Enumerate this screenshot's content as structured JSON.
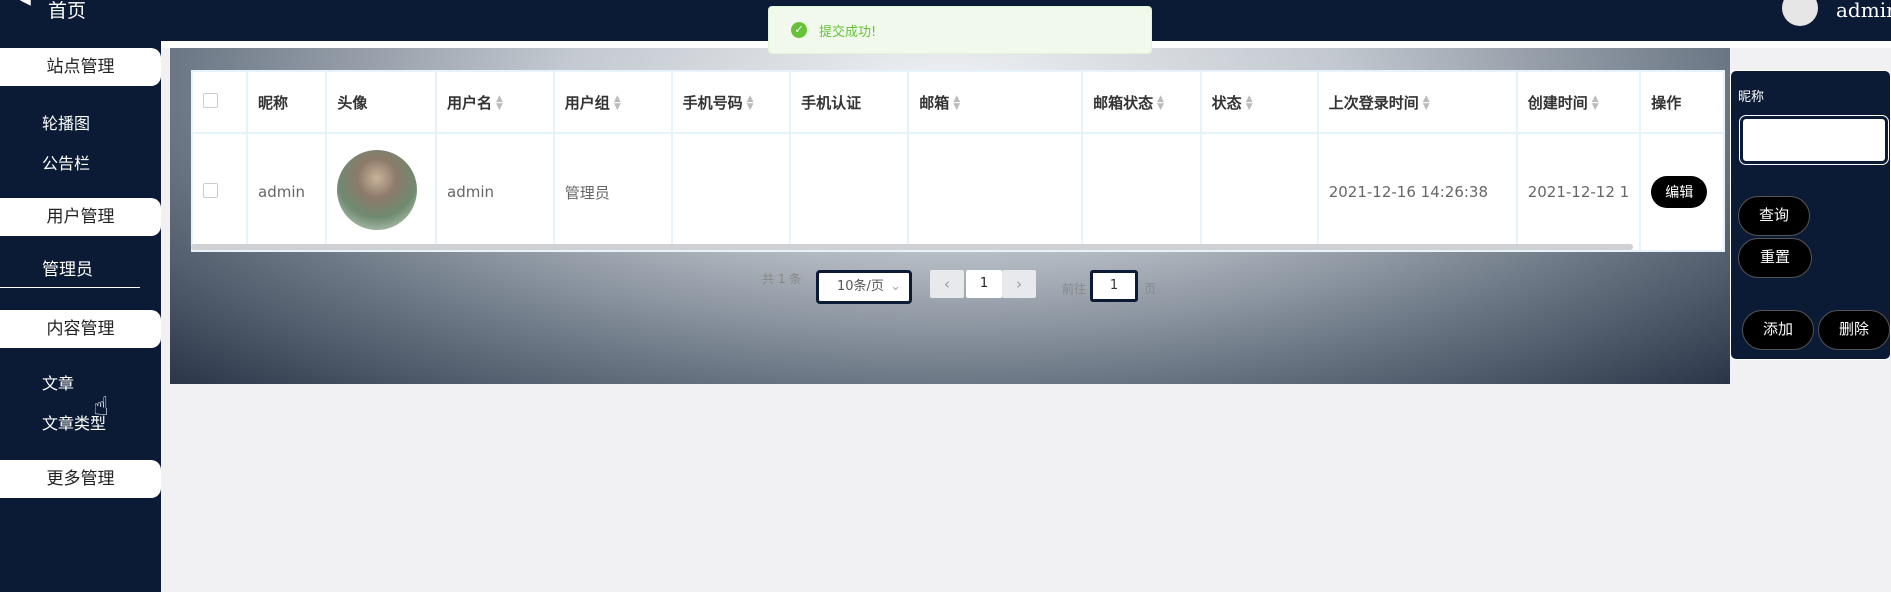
{
  "sidebar": {
    "home": "首页",
    "groups": [
      {
        "title": "站点管理",
        "items": [
          "轮播图",
          "公告栏"
        ]
      },
      {
        "title": "用户管理",
        "items": [
          "管理员"
        ]
      },
      {
        "title": "内容管理",
        "items": [
          "文章",
          "文章类型"
        ]
      },
      {
        "title": "更多管理",
        "items": []
      }
    ]
  },
  "header": {
    "user": "admin"
  },
  "toast": {
    "message": "提交成功!",
    "color": "#67c23a"
  },
  "table": {
    "columns": [
      "昵称",
      "头像",
      "用户名",
      "用户组",
      "手机号码",
      "手机认证",
      "邮箱",
      "邮箱状态",
      "状态",
      "上次登录时间",
      "创建时间",
      "操作"
    ],
    "rows": [
      {
        "nickname": "admin",
        "username": "admin",
        "group": "管理员",
        "phone": "",
        "phone_verified": "",
        "email": "",
        "email_status": "",
        "status": "",
        "last_login": "2021-12-16 14:26:38",
        "created": "2021-12-12 1",
        "action": "编辑"
      }
    ]
  },
  "pagination": {
    "total_text": "共 1 条",
    "page_size": "10条/页",
    "current_page": "1",
    "goto_prefix": "前往",
    "goto_value": "1",
    "goto_suffix": "页"
  },
  "search_panel": {
    "label": "昵称",
    "query_button": "查询",
    "reset_button": "重置",
    "add_button": "添加",
    "delete_button": "删除"
  }
}
